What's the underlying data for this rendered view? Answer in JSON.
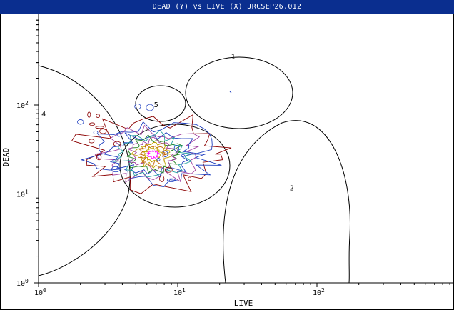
{
  "window": {
    "title": "DEAD (Y) vs LIVE (X) JRCSEP26.012"
  },
  "chart_data": {
    "type": "contour",
    "x_scale": "log",
    "y_scale": "log",
    "xlabel": "LIVE",
    "ylabel": "DEAD",
    "x_ticks": [
      {
        "value": 1,
        "base": "10",
        "exp": "0"
      },
      {
        "value": 10,
        "base": "10",
        "exp": "1"
      },
      {
        "value": 100,
        "base": "10",
        "exp": "2"
      }
    ],
    "y_ticks": [
      {
        "value": 1,
        "base": "10",
        "exp": "0"
      },
      {
        "value": 10,
        "base": "10",
        "exp": "1"
      },
      {
        "value": 100,
        "base": "10",
        "exp": "2"
      }
    ],
    "xlim": [
      1,
      10000
    ],
    "ylim": [
      1,
      1000
    ],
    "population_center": {
      "x": 7,
      "y": 28
    },
    "contour_colors": [
      "#8b0000",
      "#2040c0",
      "#a040a0",
      "#20a0a0",
      "#208020",
      "#c0a000",
      "#c06000",
      "#ff00ff"
    ],
    "gates": [
      {
        "label": "1",
        "shape": "ellipse",
        "label_x": 25,
        "label_y": 330
      },
      {
        "label": "2",
        "shape": "dome",
        "label_x": 66,
        "label_y": 11
      },
      {
        "label": "5",
        "shape": "ellipse",
        "label_x": 7,
        "label_y": 95
      },
      {
        "label": "",
        "shape": "ellipse",
        "label_x": 0,
        "label_y": 0
      },
      {
        "label": "",
        "shape": "arc",
        "label_x": 0,
        "label_y": 0
      }
    ],
    "extra_labels": [
      {
        "text": "4",
        "x": 1.05,
        "y": 80
      }
    ]
  }
}
